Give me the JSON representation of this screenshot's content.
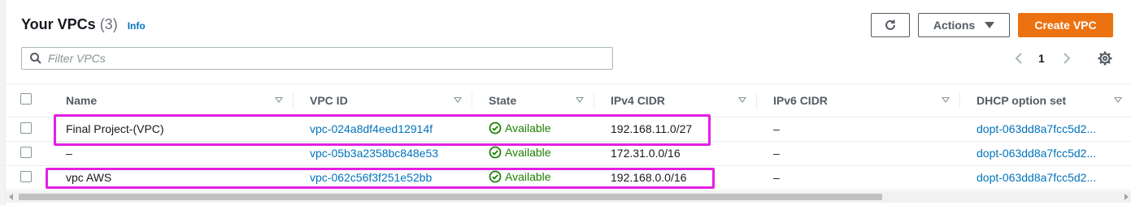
{
  "header": {
    "title": "Your VPCs",
    "count": "(3)",
    "info": "Info",
    "actions_label": "Actions",
    "create_label": "Create VPC"
  },
  "search": {
    "placeholder": "Filter VPCs",
    "value": ""
  },
  "pagination": {
    "current_page": "1"
  },
  "table": {
    "columns": [
      "Name",
      "VPC ID",
      "State",
      "IPv4 CIDR",
      "IPv6 CIDR",
      "DHCP option set"
    ],
    "rows": [
      {
        "name": "Final Project-(VPC)",
        "vpc_id": "vpc-024a8df4eed12914f",
        "state": "Available",
        "ipv4": "192.168.11.0/27",
        "ipv6": "–",
        "dhcp": "dopt-063dd8a7fcc5d2..."
      },
      {
        "name": "–",
        "vpc_id": "vpc-05b3a2358bc848e53",
        "state": "Available",
        "ipv4": "172.31.0.0/16",
        "ipv6": "–",
        "dhcp": "dopt-063dd8a7fcc5d2..."
      },
      {
        "name": "vpc AWS",
        "vpc_id": "vpc-062c56f3f251e52bb",
        "state": "Available",
        "ipv4": "192.168.0.0/16",
        "ipv6": "–",
        "dhcp": "dopt-063dd8a7fcc5d2..."
      }
    ]
  },
  "colors": {
    "primary_button": "#ec7211",
    "link": "#0073bb",
    "status_available": "#1d8102",
    "highlight_annotation": "#e41fe4"
  },
  "icons": [
    "refresh-icon",
    "caret-down-icon",
    "search-icon",
    "chevron-left-icon",
    "chevron-right-icon",
    "gear-icon",
    "sort-icon",
    "status-available-icon"
  ]
}
